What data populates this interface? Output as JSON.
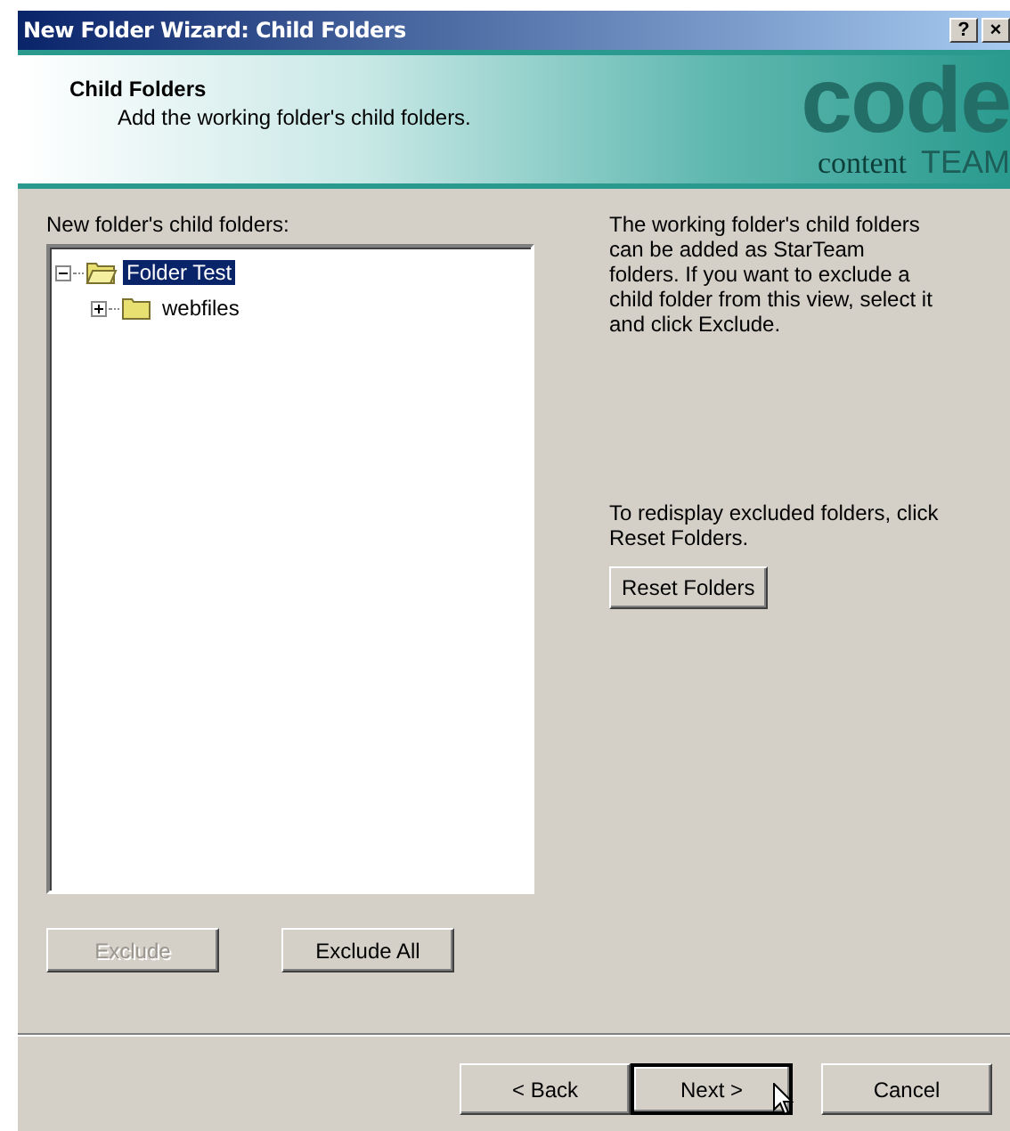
{
  "window": {
    "title": "New Folder Wizard: Child Folders",
    "title_buttons": [
      "?",
      "×"
    ]
  },
  "header": {
    "title": "Child Folders",
    "subtitle": "Add the working folder's child folders.",
    "logo": {
      "main": "code",
      "sub": "content",
      "team": "TEAM"
    }
  },
  "tree": {
    "label": "New folder's child folders:",
    "items": [
      {
        "label": "Folder Test",
        "expanded": true,
        "selected": true,
        "children": [
          {
            "label": "webfiles",
            "expanded": false,
            "selected": false
          }
        ]
      }
    ]
  },
  "help": [
    "The working folder's child folders can be added as StarTeam folders. If you want to exclude a child folder from this view, select it and click Exclude.",
    "To redisplay excluded folders, click Reset Folders."
  ],
  "reset_button": {
    "label": "Reset Folders",
    "disabled": false
  },
  "tree_buttons": [
    {
      "label": "Exclude",
      "disabled": true
    },
    {
      "label": "Exclude All",
      "disabled": false
    }
  ],
  "nav_buttons": [
    {
      "label": "< Back",
      "disabled": false,
      "default": false
    },
    {
      "label": "Next >",
      "disabled": false,
      "default": true
    },
    {
      "label": "Cancel",
      "disabled": false,
      "default": false
    }
  ]
}
